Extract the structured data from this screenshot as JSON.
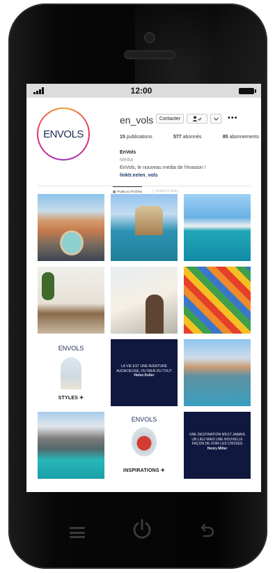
{
  "status": {
    "time": "12:00"
  },
  "profile": {
    "logo_text": "ENVOLS",
    "username": "en_vols",
    "contact_label": "Contacter",
    "follow_icon": "person-check-icon",
    "dropdown_icon": "chevron-down-icon",
    "more_label": "•••",
    "stats": {
      "publications_count": "15",
      "publications_label": "publications",
      "followers_count": "577",
      "followers_label": "abonnés",
      "following_count": "85",
      "following_label": "abonnements"
    },
    "bio": {
      "name": "EnVols",
      "category": "Média",
      "description": "EnVols, le nouveau media de l'évasion !",
      "link": "linktr.ee/en_vols"
    }
  },
  "tabs": [
    {
      "label": "PUBLICATIONS",
      "active": true
    },
    {
      "label": "IDENTIFIÉ(E)",
      "active": false
    }
  ],
  "posts": [
    {
      "kind": "photo",
      "subject": "rome-piazza"
    },
    {
      "kind": "photo",
      "subject": "coastal-castle"
    },
    {
      "kind": "photo",
      "subject": "harbor-boats"
    },
    {
      "kind": "photo",
      "subject": "interior-room"
    },
    {
      "kind": "photo",
      "subject": "airplane-boarding"
    },
    {
      "kind": "photo",
      "subject": "market-spices"
    },
    {
      "kind": "graphic",
      "logo": "ENVOLS",
      "label": "STYLES"
    },
    {
      "kind": "quote",
      "text": "LA VIE EST UNE AVENTURE AUDACIEUSE, OU RIEN DU TOUT",
      "author": "Helen Keller"
    },
    {
      "kind": "photo",
      "subject": "venice-canal"
    },
    {
      "kind": "photo",
      "subject": "mountain-lake"
    },
    {
      "kind": "graphic",
      "logo": "ENVOLS",
      "label": "INSPIRATIONS"
    },
    {
      "kind": "quote",
      "text": "UNE DESTINATION N'EST JAMAIS UN LIEU MAIS UNE NOUVELLE FAÇON DE VOIR LES CHOSES",
      "author": "Henry Miller"
    }
  ],
  "device": {
    "menu_icon": "menu-icon",
    "power_icon": "power-icon",
    "back_icon": "back-icon"
  },
  "colors": {
    "brand_navy": "#10183f",
    "avatar_gradient": [
      "#f0a030",
      "#e0306a",
      "#a030c0"
    ]
  }
}
